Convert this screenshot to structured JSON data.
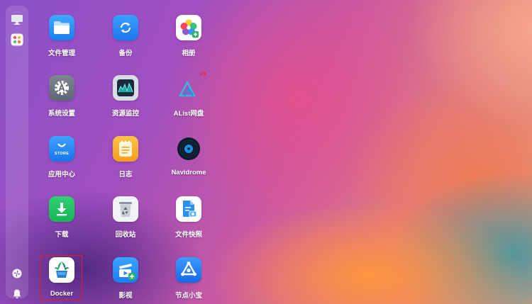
{
  "apps": {
    "files": "文件管理",
    "backup": "备份",
    "photos": "相册",
    "settings": "系统设置",
    "monitor": "资源监控",
    "alist": "AList网盘",
    "alist_badge": "V3",
    "store": "应用中心",
    "store_text": "STORE",
    "logs": "日志",
    "navidrome": "Navidrome",
    "download": "下载",
    "recycle": "回收站",
    "snapshot": "文件快照",
    "docker": "Docker",
    "video": "影视",
    "node": "节点小宝"
  },
  "colors": {
    "selection_border": "#e0201e"
  },
  "sidebar_icons": [
    "monitor-icon",
    "app-grid-icon",
    "pinwheel-icon",
    "bell-icon"
  ]
}
